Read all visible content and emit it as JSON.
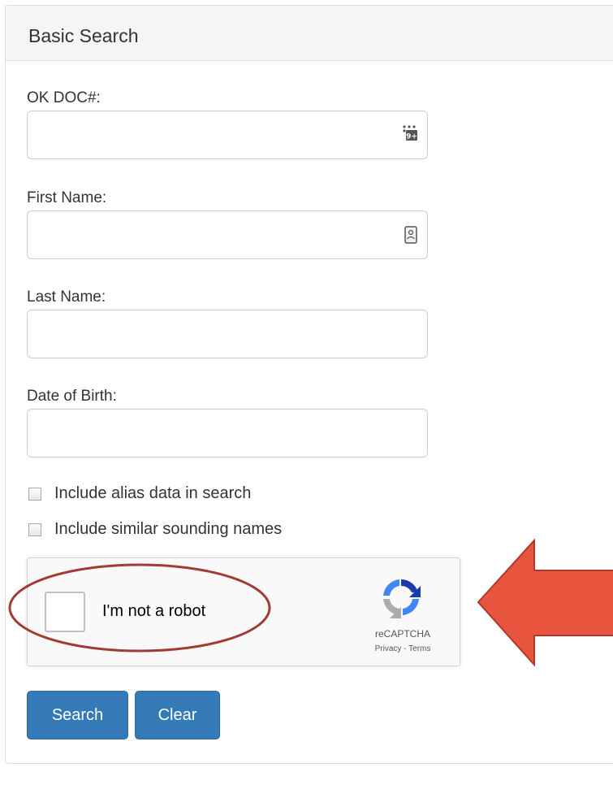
{
  "panel": {
    "title": "Basic Search"
  },
  "form": {
    "doc_number": {
      "label": "OK DOC#:",
      "value": "",
      "icon": "numeric-keypad-icon"
    },
    "first_name": {
      "label": "First Name:",
      "value": "",
      "icon": "contact-card-icon"
    },
    "last_name": {
      "label": "Last Name:",
      "value": ""
    },
    "dob": {
      "label": "Date of Birth:",
      "value": ""
    },
    "alias_checkbox": {
      "label": "Include alias data in search",
      "checked": false
    },
    "soundex_checkbox": {
      "label": "Include similar sounding names",
      "checked": false
    }
  },
  "captcha": {
    "label": "I'm not a robot",
    "brand": "reCAPTCHA",
    "links": "Privacy - Terms",
    "checked": false,
    "logo_icon": "recaptcha-logo-icon"
  },
  "buttons": {
    "search": "Search",
    "clear": "Clear"
  },
  "annotations": {
    "ellipse_color": "#a33b35",
    "arrow_color": "#e8553e",
    "arrow_border": "#b3372a"
  },
  "colors": {
    "primary": "#337ab7",
    "heading_bg": "#f5f5f5",
    "border": "#dddddd"
  }
}
